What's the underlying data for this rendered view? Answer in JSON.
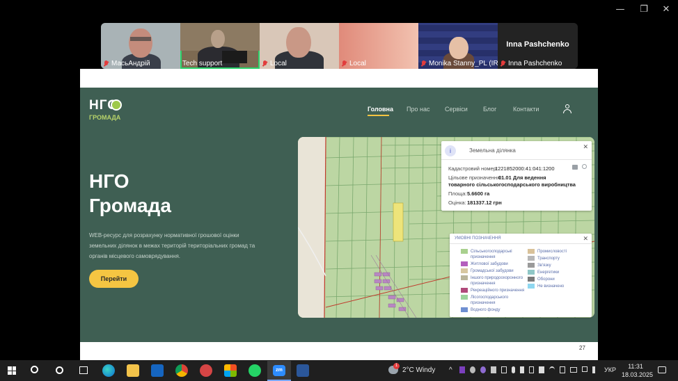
{
  "window_controls": {
    "minimize": "—",
    "restore": "❐",
    "close": "✕"
  },
  "participants": [
    {
      "name": "МасьАндрій"
    },
    {
      "name": "Tech support"
    },
    {
      "name": "Local"
    },
    {
      "name": "Local"
    },
    {
      "name": "Monika Stanny_PL (IR..."
    },
    {
      "name": "Inna Pashchenko",
      "title": "Inna Pashchenko"
    }
  ],
  "site": {
    "logo_top": "НГО",
    "logo_bottom": "ГРОМАДА",
    "nav": [
      "Головна",
      "Про нас",
      "Сервіси",
      "Блог",
      "Контакти"
    ],
    "hero_title_1": "НГО",
    "hero_title_2": "Громада",
    "hero_desc_1": "WEB-ресурс для розрахунку нормативної грошової оцінки",
    "hero_desc_2": "земельних ділянок в межах територій територіальних громад та",
    "hero_desc_3": "органів місцевого самоврядування.",
    "cta": "Перейти"
  },
  "parcel_popup": {
    "title": "Земельна ділянка",
    "cadastral_label": "Кадастровий номер:",
    "cadastral_value": "1221852000:41:041:1200",
    "purpose_label": "Цільове призначення:",
    "purpose_value": "01.01  Для ведення",
    "purpose_value_2": "товарного сільськогосподарського виробництва",
    "area_label": "Площа:",
    "area_value": "5.6600 га",
    "valuation_label": "Оцінка:",
    "valuation_value": "181337.12 грн"
  },
  "legend": {
    "title": "УМОВНІ ПОЗНАЧЕННЯ",
    "left": [
      {
        "label": "Сільськогосподарські",
        "label2": "призначення",
        "color": "#a9d08e"
      },
      {
        "label": "Житлової забудови",
        "color": "#b45fbd"
      },
      {
        "label": "Громадської забудови",
        "color": "#d7c7a0"
      },
      {
        "label": "Іншого природоохоронного",
        "label2": "призначення",
        "color": "#b9b59a"
      },
      {
        "label": "Рекреаційного призначення",
        "color": "#b04a7a"
      },
      {
        "label": "Лісогосподарського",
        "label2": "призначення",
        "color": "#9bd39b"
      },
      {
        "label": "Водного фонду",
        "color": "#6f8fd1"
      }
    ],
    "right": [
      {
        "label": "Промисловості",
        "color": "#d9c29a"
      },
      {
        "label": "Транспорту",
        "color": "#b7b7b7"
      },
      {
        "label": "Зв'язку",
        "color": "#9a9a9a"
      },
      {
        "label": "Енергетики",
        "color": "#8fc7c7"
      },
      {
        "label": "Оборони",
        "color": "#7a7a7a"
      },
      {
        "label": "Не визначено",
        "color": "#8fd7f0"
      }
    ]
  },
  "slide_number": "27",
  "taskbar": {
    "weather": "2°C  Windy",
    "weather_badge": "1",
    "lang": "УКР",
    "time": "11:31",
    "date": "18.03.2025"
  }
}
